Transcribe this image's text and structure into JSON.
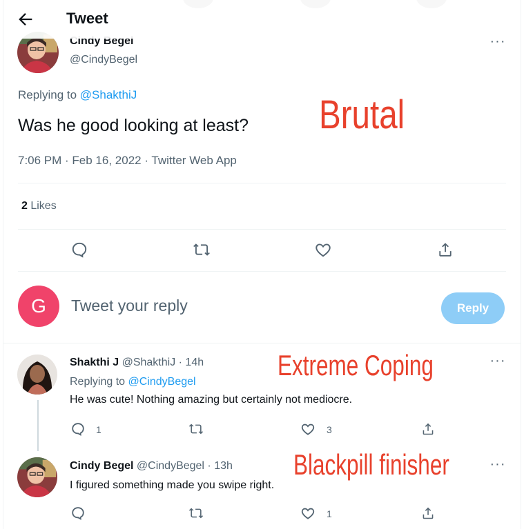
{
  "header": {
    "title": "Tweet"
  },
  "main_tweet": {
    "name": "Cindy Begel",
    "handle": "@CindyBegel",
    "replying_prefix": "Replying to ",
    "replying_handle": "@ShakthiJ",
    "text": "Was he good looking at least?",
    "meta": "7:06 PM · Feb 16, 2022 · Twitter Web App",
    "likes_count": "2",
    "likes_label": " Likes"
  },
  "composer": {
    "avatar_letter": "G",
    "placeholder": "Tweet your reply",
    "reply_label": "Reply"
  },
  "replies": [
    {
      "name": "Shakthi J",
      "handle_time": " @ShakthiJ · 14h",
      "replying_prefix": "Replying to ",
      "replying_handle": "@CindyBegel",
      "text": "He was cute! Nothing amazing but certainly not mediocre.",
      "reply_count": "1",
      "like_count": "3"
    },
    {
      "name": "Cindy Begel",
      "handle_time": " @CindyBegel · 13h",
      "text": "I figured something made you swipe right.",
      "like_count": "1"
    }
  ],
  "captions": {
    "main": "Brutal",
    "reply1": "Extreme Coping",
    "reply2": "Blackpill finisher"
  },
  "colors": {
    "accent": "#1d9bf0",
    "reply_button": "#8ecdf7",
    "caption": "#e8412c",
    "composer_avatar": "#f0436a"
  },
  "icons": [
    "back-arrow-icon",
    "more-icon",
    "reply-icon",
    "retweet-icon",
    "like-icon",
    "share-icon"
  ]
}
